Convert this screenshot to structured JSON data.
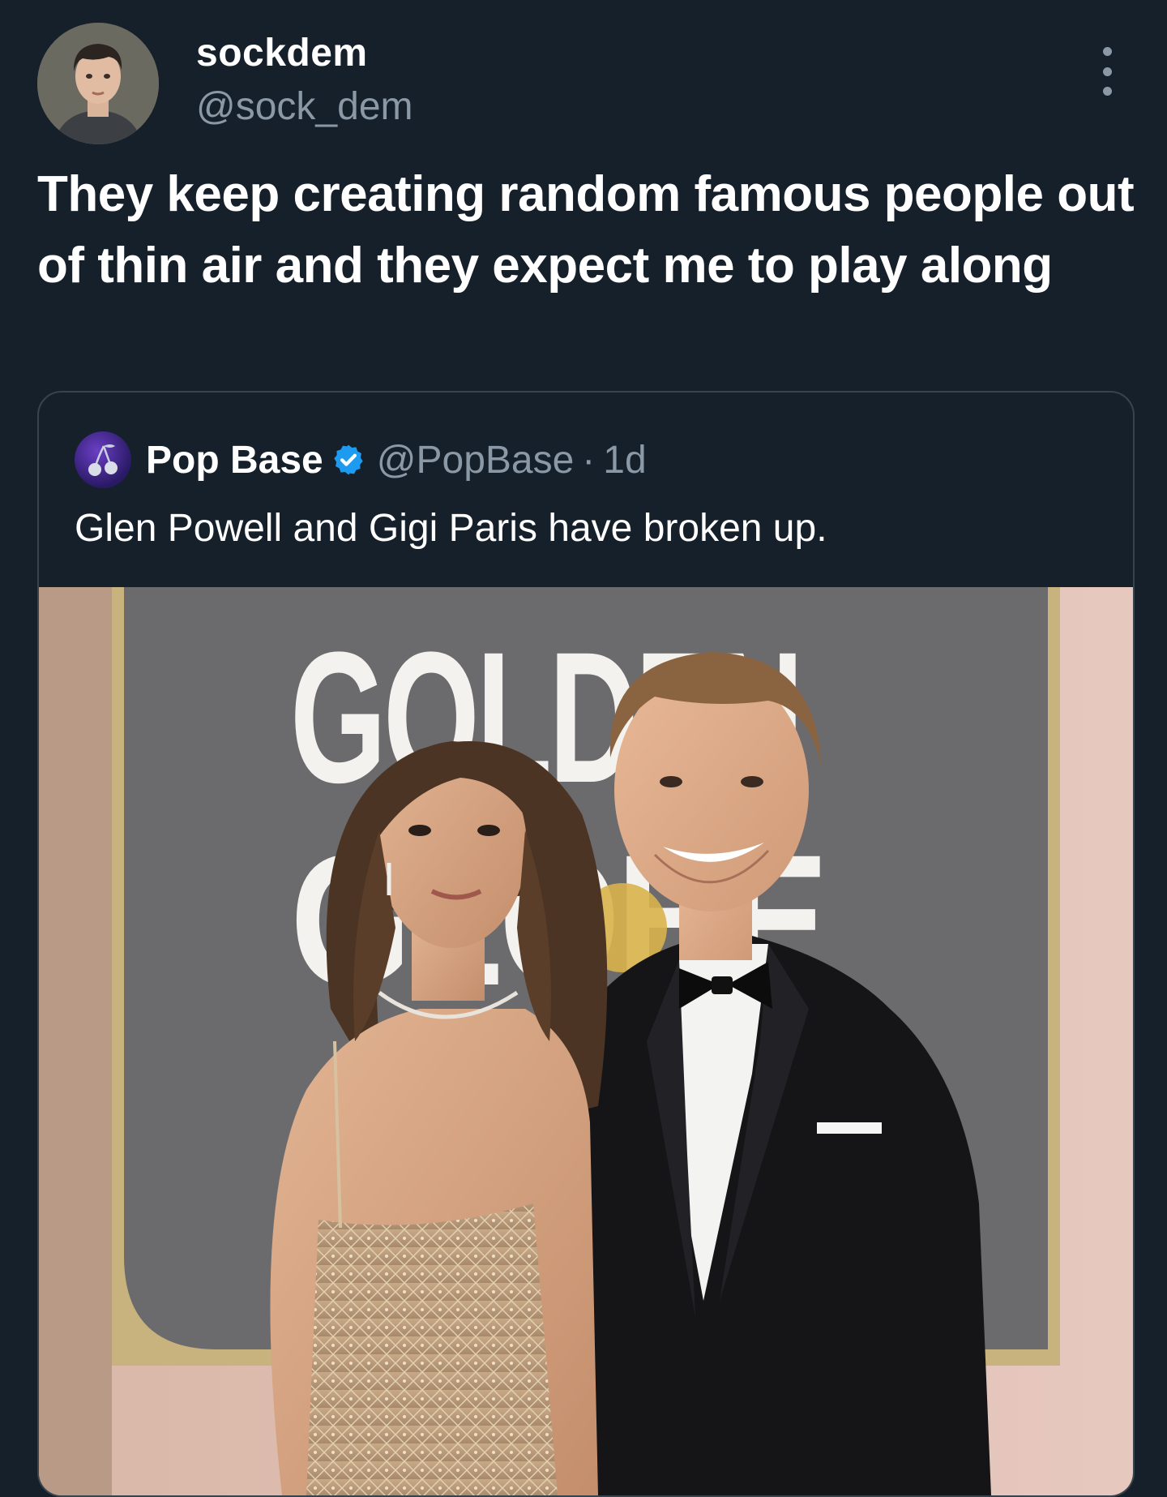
{
  "tweet": {
    "display_name": "sockdem",
    "handle": "@sock_dem",
    "text": "They keep creating random famous people out of thin air and they expect me to play along",
    "more_icon": "more-vertical-icon"
  },
  "quoted_tweet": {
    "display_name": "Pop Base",
    "verified": true,
    "verified_icon": "verified-badge-icon",
    "handle": "@PopBase",
    "separator": "·",
    "time": "1d",
    "text": "Glen Powell and Gigi Paris have broken up.",
    "image": {
      "backdrop_text_line1": "GOLDEN",
      "backdrop_text_line2": "GLOBE"
    }
  },
  "colors": {
    "background": "#15202b",
    "text_primary": "#ffffff",
    "text_secondary": "#8b98a5",
    "border": "#38444d",
    "verified_blue": "#1d9bf0"
  }
}
